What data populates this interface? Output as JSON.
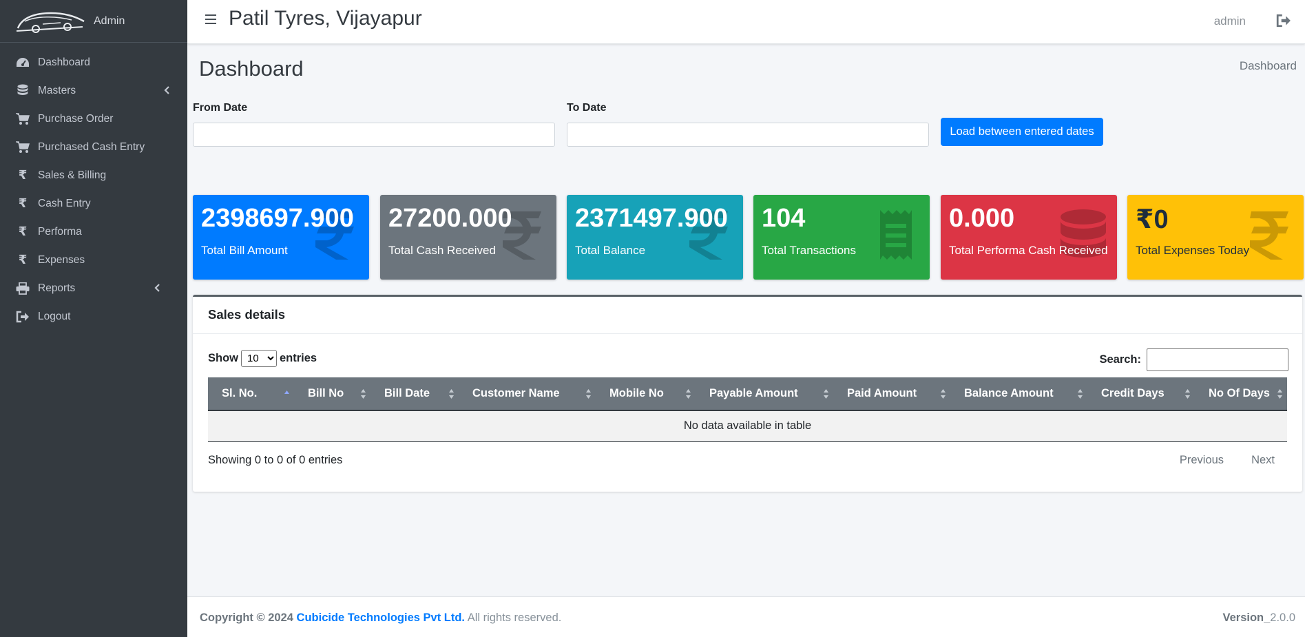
{
  "sidebar": {
    "brand_text": "Admin",
    "items": [
      {
        "label": "Dashboard",
        "icon": "tachometer-icon"
      },
      {
        "label": "Masters",
        "icon": "database-icon",
        "has_arrow": true
      },
      {
        "label": "Purchase Order",
        "icon": "cart-icon"
      },
      {
        "label": "Purchased Cash Entry",
        "icon": "cart-icon"
      },
      {
        "label": "Sales & Billing",
        "icon": "rupee-icon"
      },
      {
        "label": "Cash Entry",
        "icon": "rupee-icon"
      },
      {
        "label": "Performa",
        "icon": "rupee-icon"
      },
      {
        "label": "Expenses",
        "icon": "rupee-icon"
      },
      {
        "label": "Reports",
        "icon": "print-icon",
        "has_arrow": true
      },
      {
        "label": "Logout",
        "icon": "sign-out-icon"
      }
    ]
  },
  "header": {
    "title": "Patil Tyres, Vijayapur",
    "user": "admin"
  },
  "content": {
    "page_title": "Dashboard",
    "breadcrumb": "Dashboard"
  },
  "filters": {
    "from_label": "From Date",
    "to_label": "To Date",
    "from_value": "",
    "to_value": "",
    "load_button": "Load between entered dates"
  },
  "stats": [
    {
      "value": "2398697.900",
      "label": "Total Bill Amount",
      "color": "#007bff",
      "icon": "rupee-icon"
    },
    {
      "value": "27200.000",
      "label": "Total Cash Received",
      "color": "#6c757d",
      "icon": "rupee-icon"
    },
    {
      "value": "2371497.900",
      "label": "Total Balance",
      "color": "#17a2b8",
      "icon": "rupee-icon"
    },
    {
      "value": "104",
      "label": "Total Transactions",
      "color": "#28a745",
      "icon": "receipt-icon"
    },
    {
      "value": "0.000",
      "label": "Total Performa Cash Received",
      "color": "#dc3545",
      "icon": "database-icon"
    },
    {
      "value": "₹0",
      "label": "Total Expenses Today",
      "color": "#ffc107",
      "icon": "rupee-icon"
    }
  ],
  "sales": {
    "title": "Sales details",
    "show_label": "Show",
    "entries_label": "entries",
    "page_size": "10",
    "search_label": "Search:",
    "columns": [
      "Sl. No.",
      "Bill No",
      "Bill Date",
      "Customer Name",
      "Mobile No",
      "Payable Amount",
      "Paid Amount",
      "Balance Amount",
      "Credit Days",
      "No Of Days"
    ],
    "empty_message": "No data available in table",
    "info": "Showing 0 to 0 of 0 entries",
    "previous": "Previous",
    "next": "Next"
  },
  "footer": {
    "copyright": "Copyright © 2024",
    "company": "Cubicide Technologies Pvt Ltd.",
    "rights": "All rights reserved.",
    "version_label": "Version_",
    "version_number": "2.0.0"
  }
}
